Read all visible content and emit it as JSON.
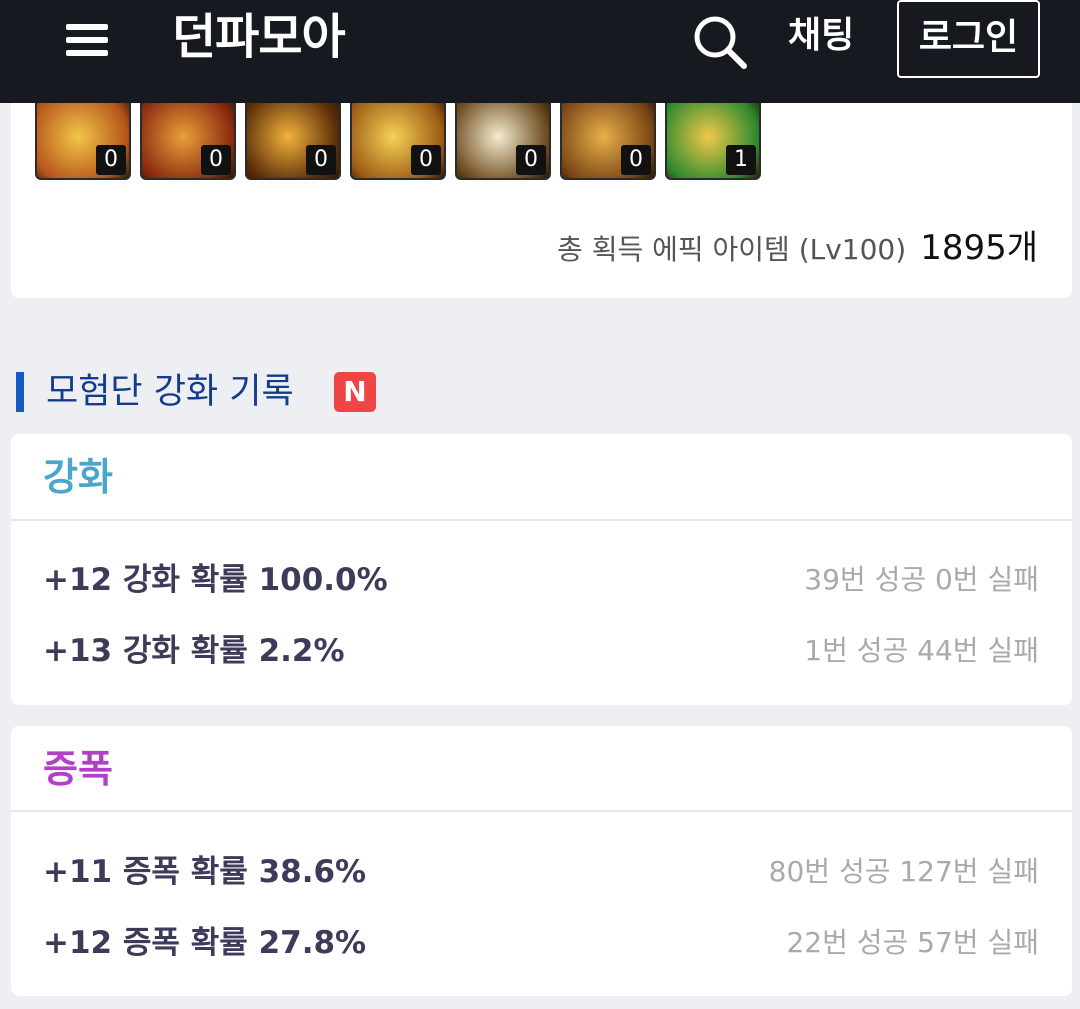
{
  "header": {
    "site_title": "던파모아",
    "chat_label": "채팅",
    "login_label": "로그인",
    "menu_icon": "hamburger-menu-icon",
    "search_icon": "search-icon",
    "bg_color": "#161a20"
  },
  "epic_summary": {
    "items": [
      {
        "count": "0",
        "color_a": "#f3c64a",
        "color_b": "#b5541a"
      },
      {
        "count": "0",
        "color_a": "#e9a13a",
        "color_b": "#8a2a10"
      },
      {
        "count": "0",
        "color_a": "#f2b23c",
        "color_b": "#5a2d08"
      },
      {
        "count": "0",
        "color_a": "#f6d257",
        "color_b": "#9c5a14"
      },
      {
        "count": "0",
        "color_a": "#f5ecd0",
        "color_b": "#6b4a1e"
      },
      {
        "count": "0",
        "color_a": "#e8b04a",
        "color_b": "#7a4516"
      },
      {
        "count": "1",
        "color_a": "#f2c84a",
        "color_b": "#2e8a2e"
      }
    ],
    "total_label": "총 획득 에픽 아이템 (Lv100)",
    "total_value": "1895개"
  },
  "section": {
    "title": "모험단 강화 기록",
    "badge": "N",
    "bar_color": "#1658c2",
    "badge_color": "#f04545"
  },
  "enhance": {
    "title": "강화",
    "title_color": "#4aa7c9",
    "rows": [
      {
        "label": "+12 강화 확률 100.0%",
        "stats": "39번 성공 0번 실패"
      },
      {
        "label": "+13 강화 확률 2.2%",
        "stats": "1번 성공 44번 실패"
      }
    ]
  },
  "amplify": {
    "title": "증폭",
    "title_color": "#b33fc7",
    "rows": [
      {
        "label": "+11 증폭 확률 38.6%",
        "stats": "80번 성공 127번 실패"
      },
      {
        "label": "+12 증폭 확률 27.8%",
        "stats": "22번 성공 57번 실패"
      }
    ]
  }
}
